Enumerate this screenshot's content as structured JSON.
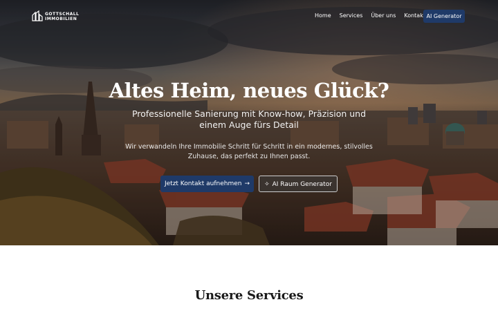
{
  "brand": {
    "name_line1": "GOTTSCHALL",
    "name_line2": "IMMOBILIEN"
  },
  "nav": {
    "items": [
      {
        "label": "Home"
      },
      {
        "label": "Services"
      },
      {
        "label": "Über uns"
      },
      {
        "label": "Kontakt"
      }
    ],
    "cta_label": "AI Generator"
  },
  "hero": {
    "title": "Altes Heim, neues Glück?",
    "subtitle": "Professionelle Sanierung mit Know-how, Präzision und einem Auge fürs Detail",
    "description": "Wir verwandeln Ihre Immobilie Schritt für Schritt in ein modernes, stilvolles Zuhause, das perfekt zu Ihnen passt.",
    "primary_button": "Jetzt Kontakt aufnehmen",
    "secondary_button": "AI Raum Generator"
  },
  "services": {
    "title": "Unsere Services"
  },
  "colors": {
    "primary": "#1f3a68",
    "text_dark": "#1a1a1a",
    "white": "#ffffff"
  },
  "icons": {
    "primary_button": "arrow-right-icon",
    "secondary_button": "sparkles-icon",
    "logo": "building-logo-icon"
  }
}
